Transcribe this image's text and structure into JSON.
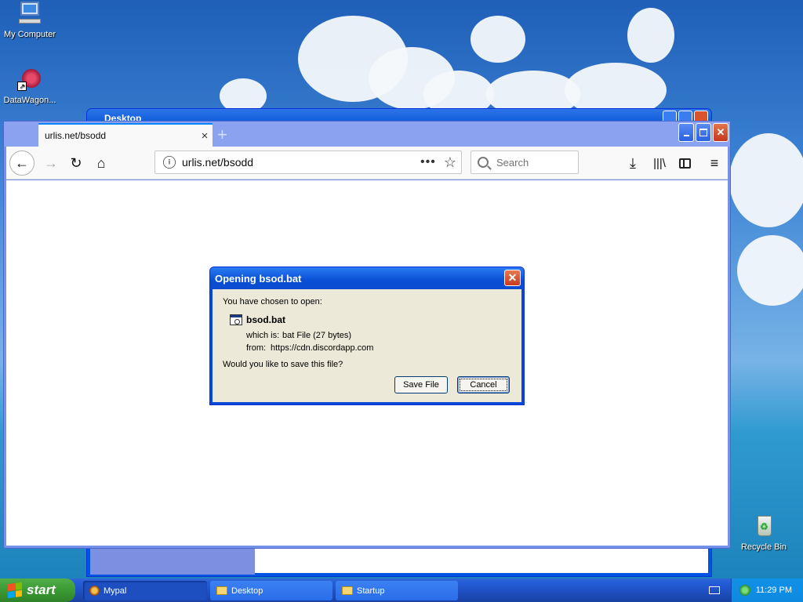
{
  "desktop": {
    "icons": [
      {
        "label": "My Computer"
      },
      {
        "label": "DataWagon..."
      },
      {
        "label": "Recycle Bin"
      }
    ]
  },
  "background_window": {
    "title": "Desktop"
  },
  "browser": {
    "tab_title": "urlis.net/bsodd",
    "tab_close": "×",
    "new_tab": "+",
    "url": "urlis.net/bsodd",
    "url_more": "•••",
    "search_placeholder": "Search"
  },
  "dialog": {
    "title": "Opening bsod.bat",
    "intro": "You have chosen to open:",
    "file_name": "bsod.bat",
    "which_is_label": "which is:",
    "which_is_value": "bat File (27 bytes)",
    "from_label": "from:",
    "from_value": "https://cdn.discordapp.com",
    "question": "Would you like to save this file?",
    "save_label": "Save File",
    "cancel_label": "Cancel"
  },
  "taskbar": {
    "start_label": "start",
    "tasks": [
      {
        "label": "Mypal",
        "icon": "mypal-icon"
      },
      {
        "label": "Desktop",
        "icon": "folder-icon"
      },
      {
        "label": "Startup",
        "icon": "folder-icon"
      }
    ],
    "clock": "11:29 PM"
  }
}
